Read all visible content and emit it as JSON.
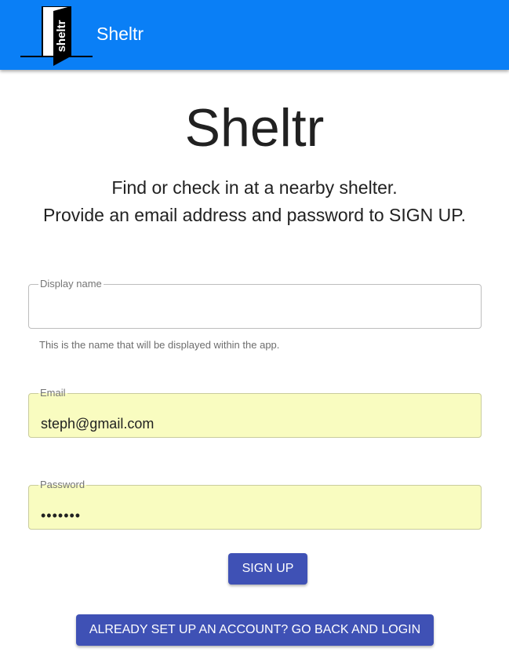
{
  "appbar": {
    "logo_text": "sheltr",
    "title": "Sheltr",
    "color": "#0a7ff6"
  },
  "hero": {
    "title": "Sheltr",
    "subtitle_line1": "Find or check in at a nearby shelter.",
    "subtitle_line2": "Provide an email address and password to SIGN UP."
  },
  "form": {
    "display_name": {
      "label": "Display name",
      "value": "",
      "helper": "This is the name that will be displayed within the app."
    },
    "email": {
      "label": "Email",
      "value": "steph@gmail.com"
    },
    "password": {
      "label": "Password",
      "value": "•••••••"
    },
    "autofill_color": "#f9fcc0"
  },
  "buttons": {
    "signup_label": "SIGN UP",
    "login_label": "ALREADY SET UP AN ACCOUNT? GO BACK AND LOGIN",
    "color": "#3f51b5"
  }
}
